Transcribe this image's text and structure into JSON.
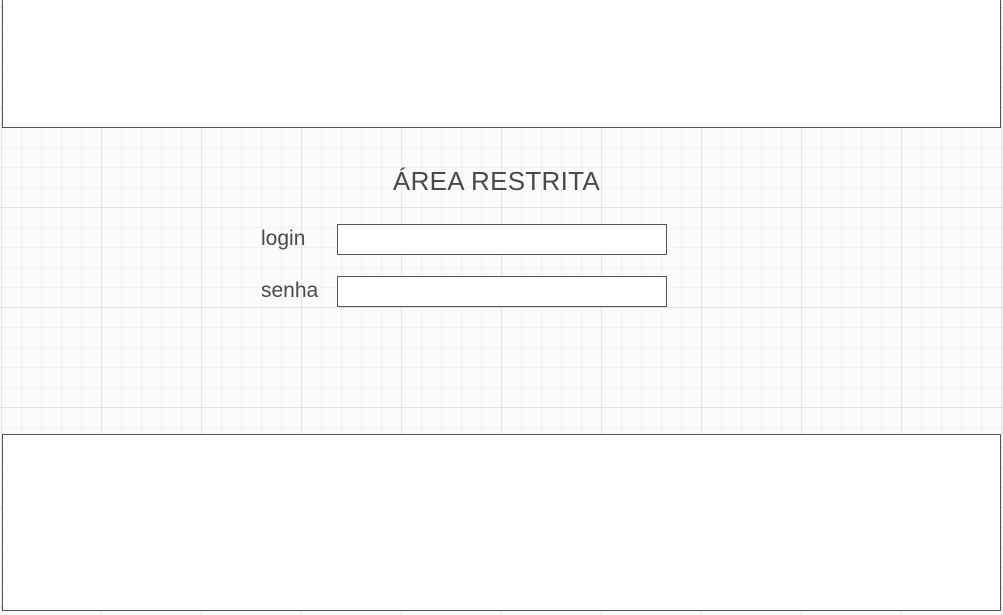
{
  "page": {
    "title": "ÁREA RESTRITA"
  },
  "form": {
    "login": {
      "label": "login",
      "value": "",
      "placeholder": ""
    },
    "senha": {
      "label": "senha",
      "value": "",
      "placeholder": ""
    }
  }
}
